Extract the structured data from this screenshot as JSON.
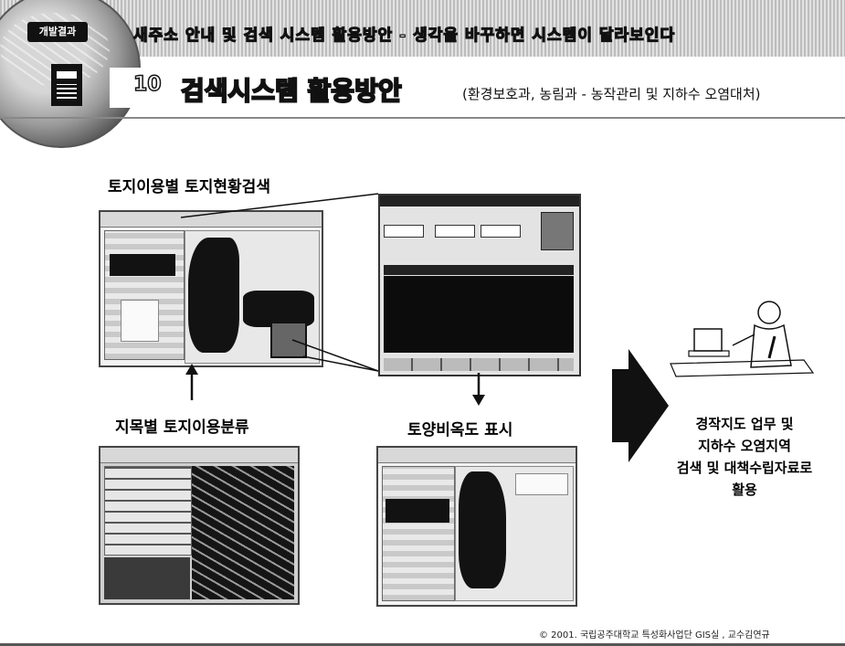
{
  "header": {
    "badge": "개발결과",
    "title": "새주소 안내 및 검색 시스템 활용방안 - 생각을 바꾸하면 시스템이 달라보인다"
  },
  "section": {
    "number": "10",
    "title": "검색시스템 활용방안",
    "subtitle": "(환경보호과, 농림과 - 농작관리 및 지하수 오염대처)"
  },
  "captions": {
    "landuse_search": "토지이용별 토지현황검색",
    "lot_classification": "지목별 토지이용분류",
    "soil_display": "토양비옥도 표시"
  },
  "result": {
    "lines": [
      "경작지도 업무 및",
      "지하수 오염지역",
      "검색 및 대책수립자료로",
      "활용"
    ]
  },
  "footer": {
    "copyright": "© 2001. 국립공주대학교 특성화사업단 GIS실 , 교수김연규"
  }
}
